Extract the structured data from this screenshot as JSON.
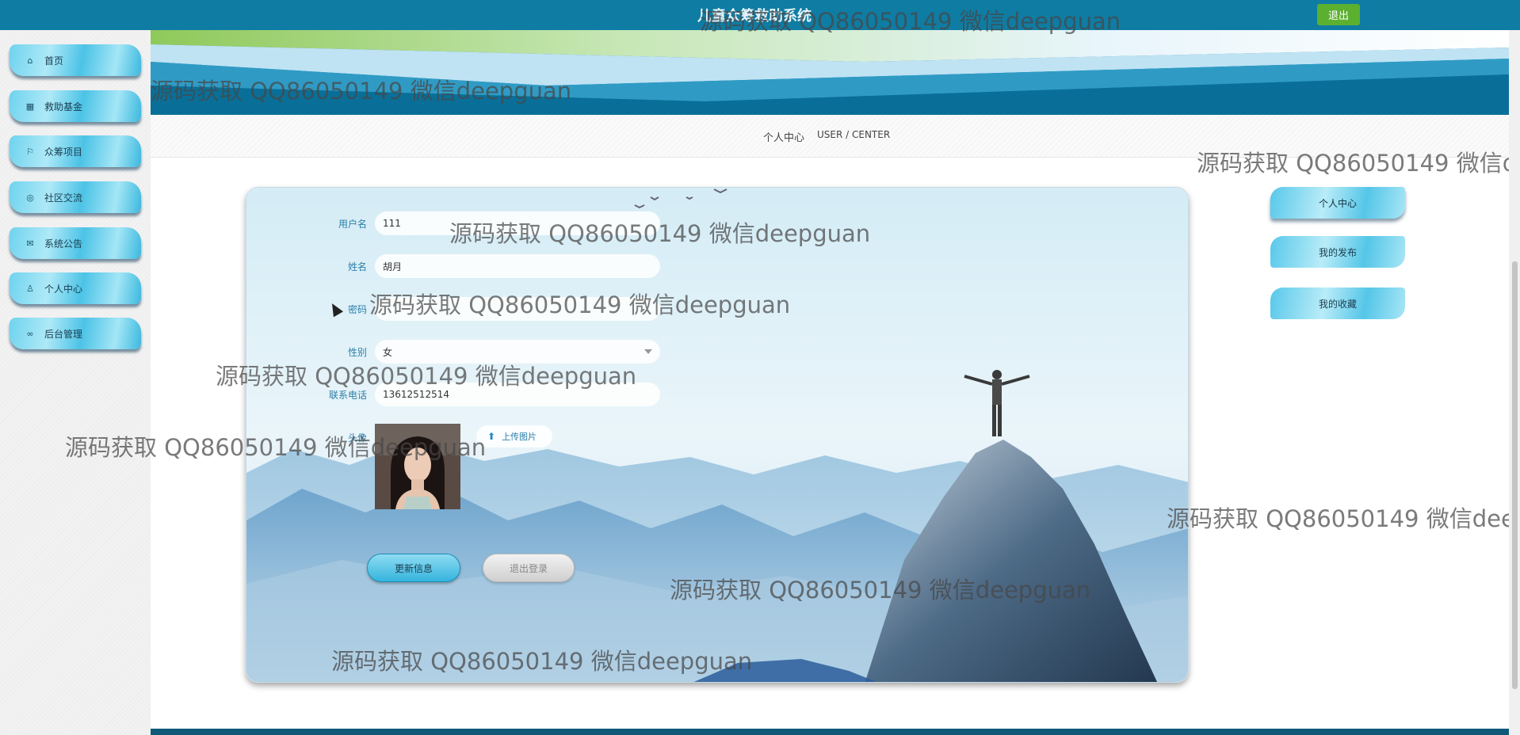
{
  "header": {
    "app_title": "儿童众筹救助系统",
    "logout_label": "退出"
  },
  "sidebar": {
    "items": [
      {
        "label": "首页",
        "icon": "home-icon"
      },
      {
        "label": "救助基金",
        "icon": "calendar-icon"
      },
      {
        "label": "众筹项目",
        "icon": "flag-icon"
      },
      {
        "label": "社区交流",
        "icon": "globe-icon"
      },
      {
        "label": "系统公告",
        "icon": "mail-icon"
      },
      {
        "label": "个人中心",
        "icon": "user-icon"
      },
      {
        "label": "后台管理",
        "icon": "link-icon"
      }
    ]
  },
  "breadcrumb": {
    "cn": "个人中心",
    "en": "USER / CENTER"
  },
  "form": {
    "username_label": "用户名",
    "username_value": "111",
    "name_label": "姓名",
    "name_value": "胡月",
    "password_label": "密码",
    "password_value": "",
    "gender_label": "性别",
    "gender_value": "女",
    "phone_label": "联系电话",
    "phone_value": "13612512514",
    "avatar_label": "头像",
    "upload_label": "上传图片",
    "update_button": "更新信息",
    "logout_button": "退出登录"
  },
  "right_menu": {
    "items": [
      {
        "label": "个人中心",
        "active": true
      },
      {
        "label": "我的发布",
        "active": false
      },
      {
        "label": "我的收藏",
        "active": false
      }
    ]
  },
  "watermark": "源码获取 QQ86050149 微信deepguan",
  "colors": {
    "topbar": "#0f7ca3",
    "accent": "#34b4dd",
    "logout_green": "#5cb030"
  }
}
